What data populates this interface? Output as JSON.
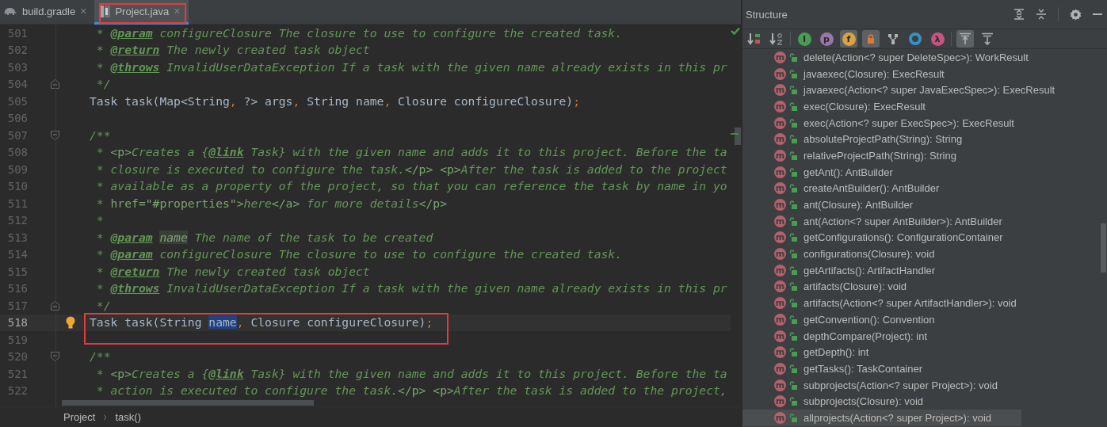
{
  "editor_tabs": [
    {
      "label": "build.gradle",
      "kind": "gradle",
      "close": "×",
      "selected": false,
      "framed": false
    },
    {
      "label": "Project.java",
      "kind": "java",
      "close": "×",
      "selected": true,
      "framed": true
    }
  ],
  "code_lines": [
    {
      "number": "501",
      "tokens": [
        {
          "kind": "comment",
          "text": " * "
        },
        {
          "kind": "tag",
          "text": "@param"
        },
        {
          "kind": "comment",
          "text": " configureClosure The closure to use to configure the created task."
        }
      ]
    },
    {
      "number": "502",
      "tokens": [
        {
          "kind": "comment",
          "text": " * "
        },
        {
          "kind": "tag",
          "text": "@return"
        },
        {
          "kind": "comment",
          "text": " The newly created task object"
        }
      ]
    },
    {
      "number": "503",
      "tokens": [
        {
          "kind": "comment",
          "text": " * "
        },
        {
          "kind": "tag",
          "text": "@throws"
        },
        {
          "kind": "comment",
          "text": " InvalidUserDataException If a task with the given name already exists in this pr"
        }
      ]
    },
    {
      "number": "504",
      "kind": "fold-end",
      "tokens": [
        {
          "kind": "comment",
          "text": " */"
        }
      ]
    },
    {
      "number": "505",
      "tokens": [
        {
          "kind": "plain",
          "text": "Task task(Map<String"
        },
        {
          "kind": "punct",
          "text": ","
        },
        {
          "kind": "plain",
          "text": " ?> args"
        },
        {
          "kind": "punct",
          "text": ","
        },
        {
          "kind": "plain",
          "text": " String name"
        },
        {
          "kind": "punct",
          "text": ","
        },
        {
          "kind": "plain",
          "text": " Closure configureClosure)"
        },
        {
          "kind": "punct",
          "text": ";"
        }
      ]
    },
    {
      "number": "506"
    },
    {
      "number": "507",
      "kind": "fold-start",
      "tokens": [
        {
          "kind": "comment",
          "text": "/**"
        }
      ]
    },
    {
      "number": "508",
      "tokens": [
        {
          "kind": "comment",
          "text": " * "
        },
        {
          "kind": "html",
          "text": "<p>"
        },
        {
          "kind": "comment",
          "text": "Creates a {"
        },
        {
          "kind": "tag",
          "text": "@link"
        },
        {
          "kind": "comment",
          "text": " Task} with the given name and adds it to this project. Before the ta"
        }
      ]
    },
    {
      "number": "509",
      "tokens": [
        {
          "kind": "comment",
          "text": " * closure is executed to configure the task."
        },
        {
          "kind": "html",
          "text": "</p> <p>"
        },
        {
          "kind": "comment",
          "text": "After the task is added to the project"
        }
      ]
    },
    {
      "number": "510",
      "tokens": [
        {
          "kind": "comment",
          "text": " * available as a property of the project, so that you can reference the task by name in yo"
        }
      ]
    },
    {
      "number": "511",
      "tokens": [
        {
          "kind": "comment",
          "text": " * "
        },
        {
          "kind": "html",
          "text": "href=\"#properties\">"
        },
        {
          "kind": "comment",
          "text": "here"
        },
        {
          "kind": "html",
          "text": "</a>"
        },
        {
          "kind": "comment",
          "text": " for more details"
        },
        {
          "kind": "html",
          "text": "</p>"
        }
      ]
    },
    {
      "number": "512",
      "tokens": [
        {
          "kind": "comment",
          "text": " *"
        }
      ]
    },
    {
      "number": "513",
      "tokens": [
        {
          "kind": "comment",
          "text": " * "
        },
        {
          "kind": "tag",
          "text": "@param"
        },
        {
          "kind": "param",
          "text": "name"
        },
        {
          "kind": "comment",
          "text": " The name of the task to be created"
        }
      ]
    },
    {
      "number": "514",
      "tokens": [
        {
          "kind": "comment",
          "text": " * "
        },
        {
          "kind": "tag",
          "text": "@param"
        },
        {
          "kind": "comment",
          "text": " configureClosure The closure to use to configure the created task."
        }
      ]
    },
    {
      "number": "515",
      "tokens": [
        {
          "kind": "comment",
          "text": " * "
        },
        {
          "kind": "tag",
          "text": "@return"
        },
        {
          "kind": "comment",
          "text": " The newly created task object"
        }
      ]
    },
    {
      "number": "516",
      "tokens": [
        {
          "kind": "comment",
          "text": " * "
        },
        {
          "kind": "tag",
          "text": "@throws"
        },
        {
          "kind": "comment",
          "text": " InvalidUserDataException If a task with the given name already exists in this pr"
        }
      ]
    },
    {
      "number": "517",
      "kind": "fold-end",
      "tokens": [
        {
          "kind": "comment",
          "text": " */"
        }
      ]
    },
    {
      "number": "518",
      "kind": "bulb",
      "current": true,
      "framed": true,
      "tokens": [
        {
          "kind": "plain",
          "text": "Task task(String "
        },
        {
          "kind": "selection",
          "text": "name"
        },
        {
          "kind": "punct",
          "text": ","
        },
        {
          "kind": "plain",
          "text": " Closure configureClosure)"
        },
        {
          "kind": "punct",
          "text": ";"
        }
      ]
    },
    {
      "number": "519"
    },
    {
      "number": "520",
      "kind": "fold-start",
      "tokens": [
        {
          "kind": "comment",
          "text": "/**"
        }
      ]
    },
    {
      "number": "521",
      "tokens": [
        {
          "kind": "comment",
          "text": " * "
        },
        {
          "kind": "html",
          "text": "<p>"
        },
        {
          "kind": "comment",
          "text": "Creates a {"
        },
        {
          "kind": "tag",
          "text": "@link"
        },
        {
          "kind": "comment",
          "text": " Task} with the given name and adds it to this project. Before the ta"
        }
      ]
    },
    {
      "number": "522",
      "tokens": [
        {
          "kind": "comment",
          "text": " * action is executed to configure the task."
        },
        {
          "kind": "html",
          "text": "</p> <p>"
        },
        {
          "kind": "comment",
          "text": "After the task is added to the project,"
        }
      ]
    }
  ],
  "breadcrumbs": [
    "Project",
    "task()"
  ],
  "structure": {
    "title": "Structure",
    "toolbar_groups": [
      {
        "items": [
          {
            "kind": "sort-visibility",
            "on": false
          },
          {
            "kind": "sort-alpha",
            "on": false
          }
        ]
      },
      {
        "items": [
          {
            "kind": "inherited",
            "glyph": "I",
            "on": false
          },
          {
            "kind": "properties",
            "glyph": "p",
            "on": false
          },
          {
            "kind": "fields",
            "glyph": "f",
            "on": true
          },
          {
            "kind": "non-public",
            "on": true
          },
          {
            "kind": "hierarchy",
            "on": false
          },
          {
            "kind": "anonymous",
            "on": false
          },
          {
            "kind": "lambdas",
            "glyph": "λ",
            "on": false
          }
        ]
      },
      {
        "items": [
          {
            "kind": "autoscroll-to-source",
            "on": true
          },
          {
            "kind": "autoscroll-from-source",
            "on": false
          }
        ]
      }
    ],
    "items": [
      {
        "icon": "m",
        "name": "delete(Action<? super DeleteSpec>): WorkResult",
        "selected": false
      },
      {
        "icon": "m",
        "name": "javaexec(Closure): ExecResult",
        "selected": false
      },
      {
        "icon": "m",
        "name": "javaexec(Action<? super JavaExecSpec>): ExecResult",
        "selected": false
      },
      {
        "icon": "m",
        "name": "exec(Closure): ExecResult",
        "selected": false
      },
      {
        "icon": "m",
        "name": "exec(Action<? super ExecSpec>): ExecResult",
        "selected": false
      },
      {
        "icon": "m",
        "name": "absoluteProjectPath(String): String",
        "selected": false
      },
      {
        "icon": "m",
        "name": "relativeProjectPath(String): String",
        "selected": false
      },
      {
        "icon": "m",
        "name": "getAnt(): AntBuilder",
        "selected": false
      },
      {
        "icon": "m",
        "name": "createAntBuilder(): AntBuilder",
        "selected": false
      },
      {
        "icon": "m",
        "name": "ant(Closure): AntBuilder",
        "selected": false
      },
      {
        "icon": "m",
        "name": "ant(Action<? super AntBuilder>): AntBuilder",
        "selected": false
      },
      {
        "icon": "m",
        "name": "getConfigurations(): ConfigurationContainer",
        "selected": false
      },
      {
        "icon": "m",
        "name": "configurations(Closure): void",
        "selected": false
      },
      {
        "icon": "m",
        "name": "getArtifacts(): ArtifactHandler",
        "selected": false
      },
      {
        "icon": "m",
        "name": "artifacts(Closure): void",
        "selected": false
      },
      {
        "icon": "m",
        "name": "artifacts(Action<? super ArtifactHandler>): void",
        "selected": false
      },
      {
        "icon": "m",
        "name": "getConvention(): Convention",
        "selected": false
      },
      {
        "icon": "m",
        "name": "depthCompare(Project): int",
        "selected": false
      },
      {
        "icon": "m",
        "name": "getDepth(): int",
        "selected": false
      },
      {
        "icon": "m",
        "name": "getTasks(): TaskContainer",
        "selected": false
      },
      {
        "icon": "m",
        "name": "subprojects(Action<? super Project>): void",
        "selected": false
      },
      {
        "icon": "m",
        "name": "subprojects(Closure): void",
        "selected": false
      },
      {
        "icon": "m",
        "name": "allprojects(Action<? super Project>): void",
        "selected": true
      }
    ]
  }
}
